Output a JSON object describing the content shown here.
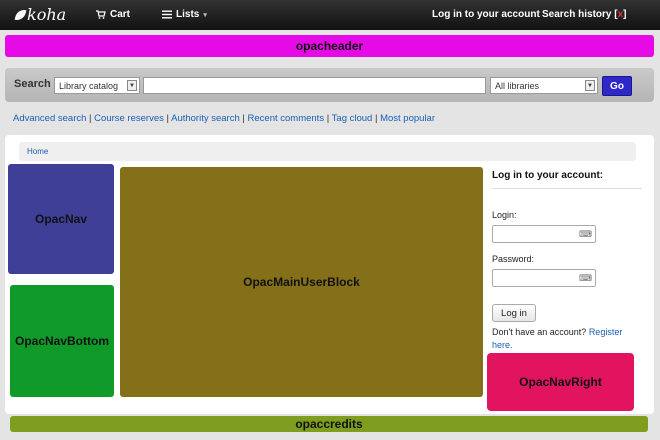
{
  "topbar": {
    "logo": "koha",
    "cart": "Cart",
    "lists": "Lists",
    "lists_caret": "▾",
    "login": "Log in to your account",
    "search_history": "Search history [",
    "search_history_x": "x",
    "search_history_end": "]"
  },
  "regions": {
    "opacheader": "opacheader",
    "opacnav": "OpacNav",
    "opacnavbottom": "OpacNavBottom",
    "opacmainuserblock": "OpacMainUserBlock",
    "opacnavright": "OpacNavRight",
    "opaccredits": "opaccredits"
  },
  "search": {
    "label": "Search",
    "catalog_selected": "Library catalog",
    "query": "",
    "libraries_selected": "All libraries",
    "go": "Go"
  },
  "more_searches": [
    "Advanced search",
    "Course reserves",
    "Authority search",
    "Recent comments",
    "Tag cloud",
    "Most popular"
  ],
  "breadcrumbs": {
    "home": "Home"
  },
  "login": {
    "title": "Log in to your account:",
    "login_label": "Login:",
    "password_label": "Password:",
    "button": "Log in",
    "no_account": "Don't have an account?",
    "register": "Register here."
  },
  "colors": {
    "opacheader": "#e60be6",
    "opacnav": "#3f3f98",
    "opacnavbottom": "#109a2a",
    "opacmainuserblock": "#85701a",
    "opacnavright": "#e2135f",
    "opaccredits": "#7f9e1f",
    "go_button": "#2f28c9"
  },
  "icons": {
    "logo": "koha-leaf-icon",
    "cart": "cart-icon",
    "lists": "list-icon",
    "password_key": "keyboard-icon"
  }
}
